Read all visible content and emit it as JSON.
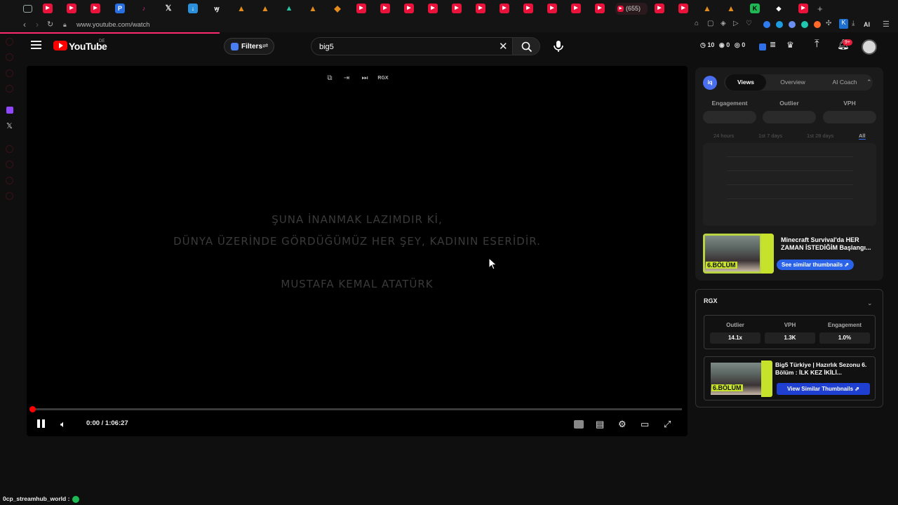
{
  "browser": {
    "url": "www.youtube.com/watch",
    "active_tab_count": "(655)",
    "profile_initial": "K",
    "ai_label": "AI"
  },
  "header": {
    "logo_text": "YouTube",
    "region": "DE",
    "filters_label": "Filters",
    "search_value": "big5",
    "stats": {
      "a": "10",
      "b": "0",
      "c": "0"
    },
    "notifications_badge": "9+"
  },
  "player": {
    "quote_line1": "ŞUNA İNANMAK LAZIMDIR Kİ,",
    "quote_line2": "DÜNYA ÜZERİNDE GÖRDÜĞÜMÜZ HER ŞEY, KADININ ESERİDİR.",
    "quote_author": "MUSTAFA KEMAL ATATÜRK",
    "tool_rgx": "RGX",
    "time_display": "0:00 / 1:06:27",
    "progress_percent": 0
  },
  "views_panel": {
    "tabs": [
      "Views",
      "Overview",
      "AI Coach"
    ],
    "active_tab": "Views",
    "metrics": [
      "Engagement",
      "Outlier",
      "VPH"
    ],
    "ranges": [
      "24 hours",
      "1st 7 days",
      "1st 28 days",
      "All"
    ],
    "active_range": "All",
    "video_title": "Minecraft Survival'da HER ZAMAN İSTEDİĞİM Başlangı...",
    "thumb_label": "6.BÖLÜM",
    "similar_label": "See similar thumbnails ⇗"
  },
  "rgx_panel": {
    "logo": "RGX",
    "stats": [
      {
        "label": "Outlier",
        "value": "14.1x"
      },
      {
        "label": "VPH",
        "value": "1.3K"
      },
      {
        "label": "Engagement",
        "value": "1.0%"
      }
    ],
    "video_title": "Big5 Türkiye | Hazırlık Sezonu 6. Bölüm : İLK KEZ İKİLİ...",
    "thumb_label": "6.BÖLÜM",
    "similar_label": "View Similar Thumbnails ⇗"
  },
  "status": {
    "text": "0cp_streamhub_world :"
  },
  "colors": {
    "accent_red": "#ff0000",
    "brand_blue": "#2a62e8",
    "thumb_lime": "#c6e22b"
  }
}
